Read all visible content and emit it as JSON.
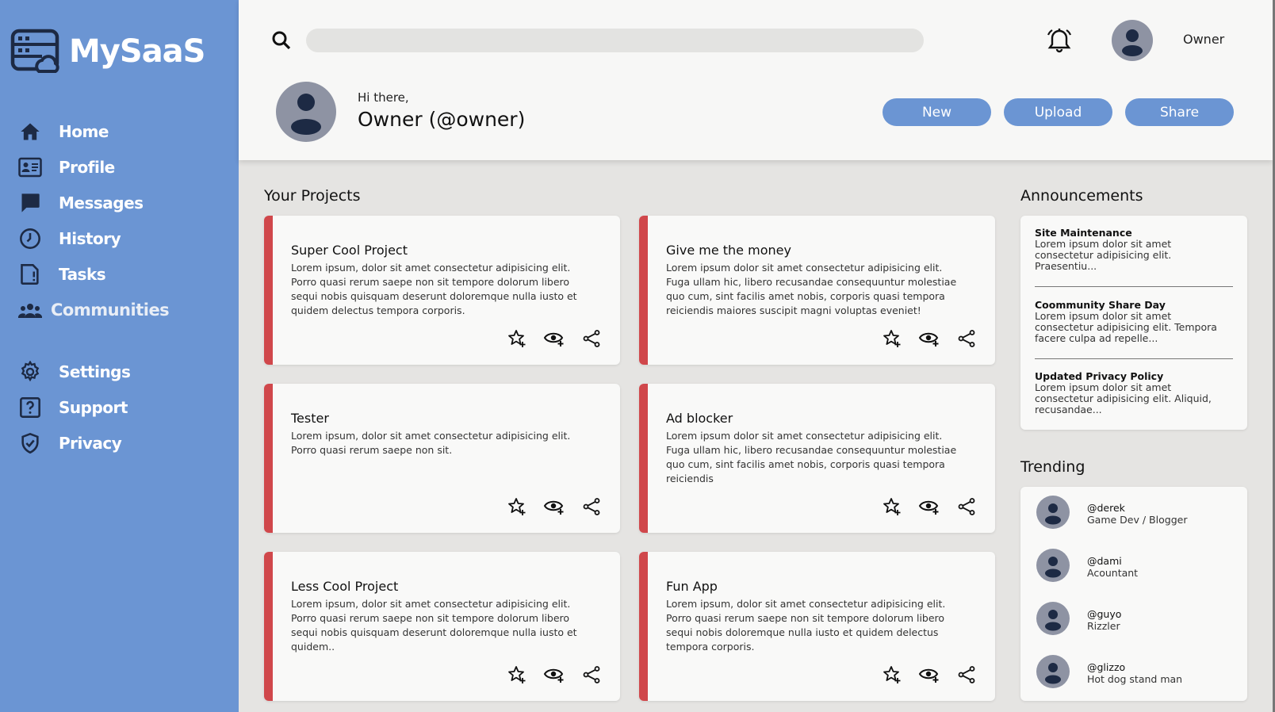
{
  "app": {
    "name": "MySaaS"
  },
  "sidebar": {
    "items": [
      {
        "label": "Home",
        "icon": "home-icon"
      },
      {
        "label": "Profile",
        "icon": "id-card-icon"
      },
      {
        "label": "Messages",
        "icon": "chat-bubble-icon"
      },
      {
        "label": "History",
        "icon": "clock-icon"
      },
      {
        "label": "Tasks",
        "icon": "task-document-icon"
      },
      {
        "label": "Communities",
        "icon": "group-icon"
      },
      {
        "label": "Settings",
        "icon": "gear-icon"
      },
      {
        "label": "Support",
        "icon": "help-icon"
      },
      {
        "label": "Privacy",
        "icon": "shield-icon"
      }
    ]
  },
  "header": {
    "search": {
      "placeholder": ""
    },
    "user_name": "Owner",
    "greeting": "Hi there,",
    "display_name": "Owner (@owner)",
    "buttons": {
      "new": "New",
      "upload": "Upload",
      "share": "Share"
    }
  },
  "projects": {
    "title": "Your Projects",
    "cards": [
      {
        "title": "Super Cool Project",
        "desc": "Lorem ipsum, dolor sit amet consectetur adipisicing elit. Porro quasi rerum saepe non sit tempore dolorum libero sequi nobis quisquam deserunt doloremque nulla iusto et quidem delectus tempora corporis."
      },
      {
        "title": "Give me the money",
        "desc": "Lorem ipsum dolor sit amet consectetur adipisicing elit. Fuga ullam hic, libero recusandae consequuntur molestiae quo cum, sint facilis amet nobis, corporis quasi tempora reiciendis maiores suscipit magni voluptas eveniet!"
      },
      {
        "title": "Tester",
        "desc": "Lorem ipsum, dolor sit amet consectetur adipisicing elit. Porro quasi rerum saepe non sit."
      },
      {
        "title": "Ad blocker",
        "desc": "Lorem ipsum dolor sit amet consectetur adipisicing elit. Fuga ullam hic, libero recusandae consequuntur molestiae quo cum, sint facilis amet nobis, corporis quasi tempora reiciendis"
      },
      {
        "title": "Less Cool Project",
        "desc": "Lorem ipsum, dolor sit amet consectetur adipisicing elit. Porro quasi rerum saepe non sit tempore dolorum libero sequi nobis quisquam deserunt doloremque nulla iusto et quidem.."
      },
      {
        "title": "Fun App",
        "desc": "Lorem ipsum, dolor sit amet consectetur adipisicing elit. Porro quasi rerum saepe non sit tempore dolorum libero sequi nobis doloremque nulla iusto et quidem delectus tempora corporis."
      }
    ]
  },
  "announcements": {
    "title": "Announcements",
    "items": [
      {
        "title": "Site Maintenance",
        "desc": "Lorem ipsum dolor sit amet consectetur adipisicing elit. Praesentiu..."
      },
      {
        "title": "Coommunity Share Day",
        "desc": "Lorem ipsum dolor sit amet consectetur adipisicing elit. Tempora facere culpa ad repelle..."
      },
      {
        "title": "Updated Privacy Policy",
        "desc": "Lorem ipsum dolor sit amet consectetur adipisicing elit. Aliquid, recusandae..."
      }
    ]
  },
  "trending": {
    "title": "Trending",
    "items": [
      {
        "handle": "@derek",
        "role": "Game Dev / Blogger"
      },
      {
        "handle": "@dami",
        "role": "Acountant"
      },
      {
        "handle": "@guyo",
        "role": "Rizzler"
      },
      {
        "handle": "@glizzo",
        "role": "Hot dog stand man"
      }
    ]
  },
  "colors": {
    "sidebar": "#6b95d3",
    "accent": "#6b95d3",
    "card_bar": "#d0474b",
    "background": "#e5e4e2"
  }
}
